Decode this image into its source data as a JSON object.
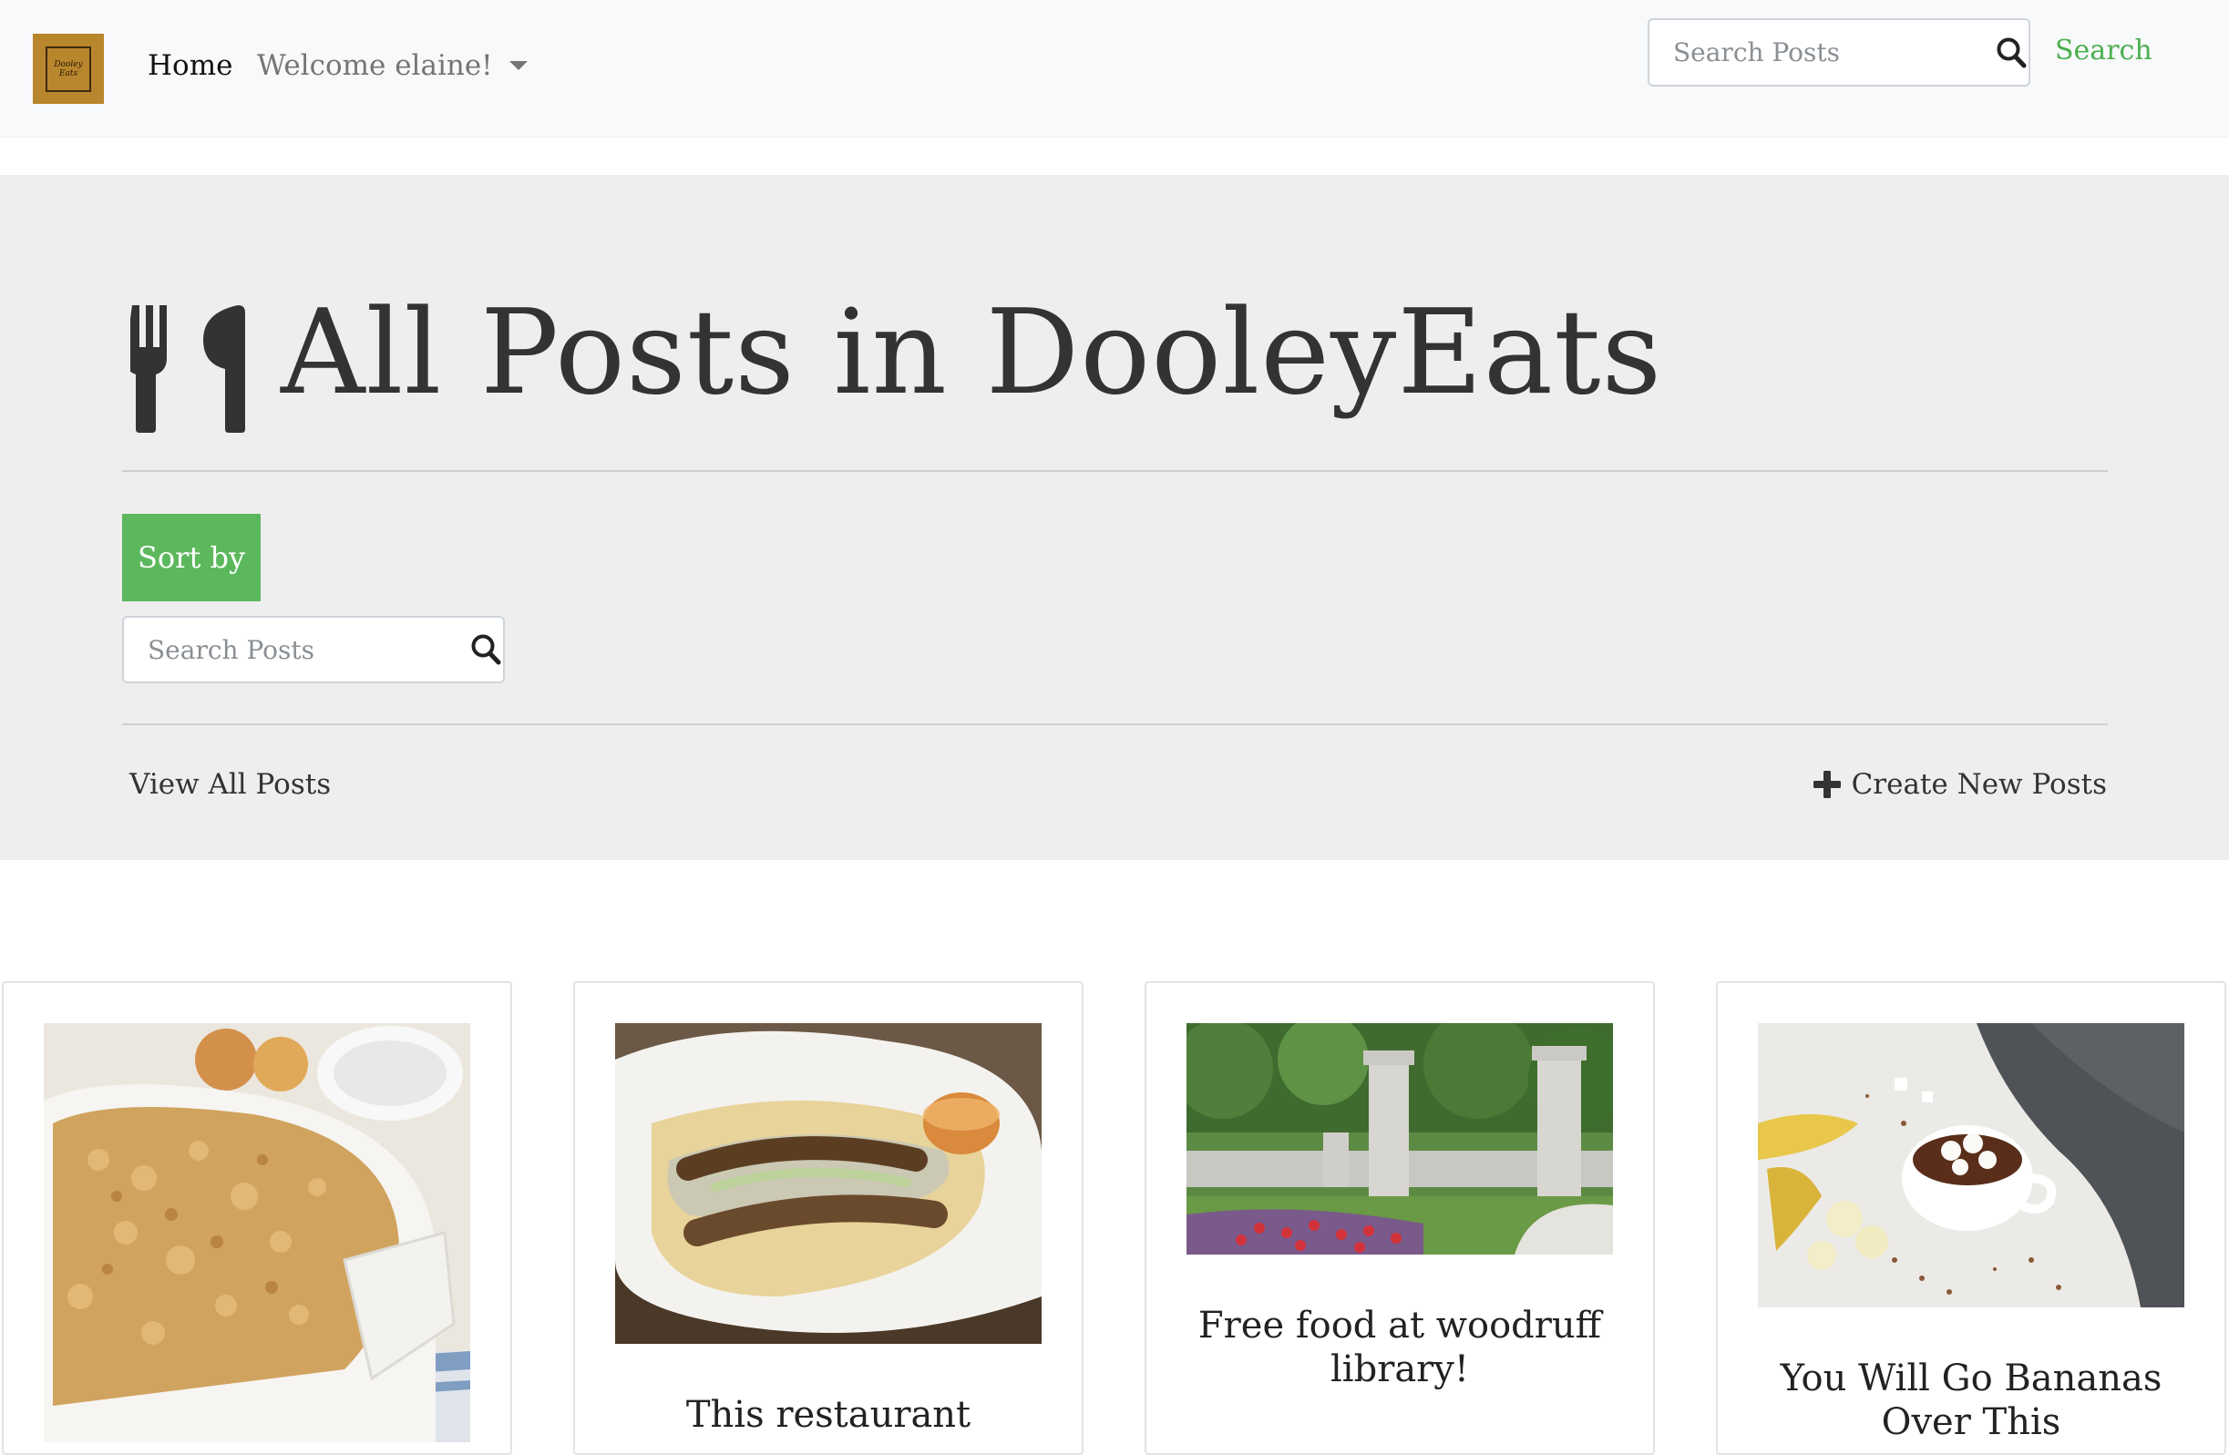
{
  "navbar": {
    "logo_text": "Dooley Eats",
    "home_label": "Home",
    "welcome_label": "Welcome elaine!",
    "search_placeholder": "Search Posts",
    "search_link_label": "Search"
  },
  "jumbotron": {
    "title": "All Posts in DooleyEats",
    "sort_label": "Sort by",
    "search_placeholder": "Search Posts",
    "view_all_label": "View All Posts",
    "create_new_label": "Create New Posts"
  },
  "posts": [
    {
      "title": "",
      "image": "apple crumble in white baking dish"
    },
    {
      "title": "This restaurant",
      "image": "spring rolls in paper basket"
    },
    {
      "title": "Free food at woodruff library!",
      "image": "campus gate with flower garden"
    },
    {
      "title": "You Will Go Bananas Over This",
      "image": "hot chocolate with marshmallows and bananas"
    }
  ],
  "colors": {
    "accent_green": "#5cb85c",
    "link_green": "#4caf50",
    "jumbotron_bg": "#eeeeee",
    "navbar_bg": "#f8f9fa",
    "logo_gold": "#b8862c"
  },
  "icons": {
    "utensils": "utensils-icon",
    "search": "search-icon",
    "plus": "plus-icon",
    "caret": "caret-down-icon"
  }
}
